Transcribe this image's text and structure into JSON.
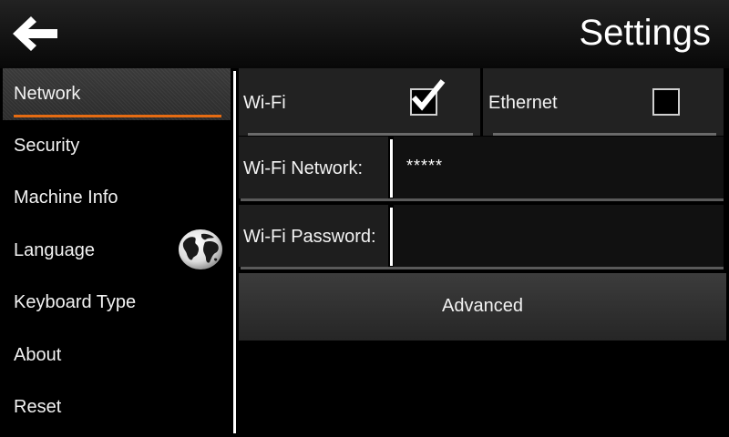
{
  "header": {
    "title": "Settings",
    "back_icon": "arrow-left-icon"
  },
  "sidebar": {
    "items": [
      {
        "label": "Network",
        "active": true
      },
      {
        "label": "Security"
      },
      {
        "label": "Machine Info"
      },
      {
        "label": "Language",
        "icon": "globe-icon"
      },
      {
        "label": "Keyboard Type"
      },
      {
        "label": "About"
      },
      {
        "label": "Reset"
      }
    ],
    "accent_color": "#e56b12"
  },
  "network": {
    "wifi": {
      "label": "Wi-Fi",
      "checked": true
    },
    "ethernet": {
      "label": "Ethernet",
      "checked": false
    },
    "wifi_network": {
      "label": "Wi-Fi Network:",
      "value": "*****"
    },
    "wifi_password": {
      "label": "Wi-Fi Password:",
      "value": ""
    },
    "advanced_label": "Advanced"
  }
}
